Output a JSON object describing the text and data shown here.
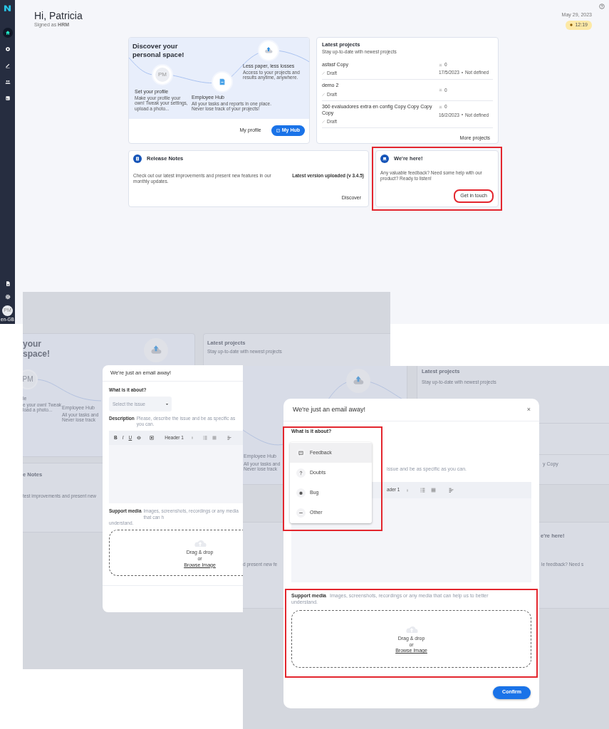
{
  "sidebar": {
    "nav_items": [
      {
        "selected": true
      },
      {
        "selected": false
      },
      {
        "selected": false
      },
      {
        "selected": false
      },
      {
        "selected": false
      }
    ],
    "avatar": "PM",
    "locale": "en-GB"
  },
  "header": {
    "greeting": "Hi, Patricia",
    "signed_as": "Signed as **HRM**",
    "date": "May 29, 2023",
    "clock": "12:19"
  },
  "discover_card": {
    "title": "Discover your personal space!",
    "steps": [
      {
        "title": "Set your profile",
        "text": "Make your profile your own! Tweak your settings, upload a photo...",
        "avatar": "PM"
      },
      {
        "title": "Employee Hub",
        "text": "All your tasks and reports in one place. Never lose track of your projects!"
      },
      {
        "title": "Less paper, less losses",
        "text": "Access to your projects and results anytime, anywhere."
      }
    ],
    "buttons": [
      {
        "label": "My profile",
        "primary": false
      },
      {
        "label": "My Hub",
        "primary": true
      }
    ]
  },
  "projects_card": {
    "title": "Latest projects",
    "subtitle": "Stay up-to-date with newest projects",
    "rows": [
      {
        "name": "asfasf Copy",
        "status": "Draft",
        "members": "0",
        "date": "17/5/2023",
        "deadline": "Not defined"
      },
      {
        "name": "demo 2",
        "status": "Draft",
        "members": "0"
      },
      {
        "name": "360 evaluadores extra en config Copy Copy Copy Copy",
        "status": "Draft",
        "members": "0",
        "date": "16/2/2023",
        "deadline": "Not defined"
      }
    ],
    "more": "More projects"
  },
  "release_card": {
    "title": "Release Notes",
    "text": "Check out our latest improvements and present new features in our monthly updates.",
    "version": "Latest version uploaded (v 3.4.5)",
    "button": "Discover"
  },
  "contact_card": {
    "title": "We're here!",
    "text": "Any valuable feedback? Need some help with our product? Ready to listen!",
    "highlighted": true,
    "button": {
      "label": "Get in touch",
      "circled": true
    }
  },
  "screen_2": {
    "background_texts": [
      {
        "text": "your",
        "kind": "heading"
      },
      {
        "text": "space!",
        "kind": "heading"
      },
      {
        "text": "PM",
        "kind": "avatar"
      },
      {
        "text": "le",
        "kind": "label"
      },
      {
        "text": "e your own! Tweak",
        "kind": "text"
      },
      {
        "text": "load a photo...",
        "kind": "text"
      },
      {
        "text": "Employee Hub",
        "kind": "label"
      },
      {
        "text": "All your tasks and",
        "kind": "text"
      },
      {
        "text": "Never lose track",
        "kind": "text"
      },
      {
        "text": "Latest projects",
        "kind": "title"
      },
      {
        "text": "Stay up-to-date with newest projects",
        "kind": "text"
      },
      {
        "text": "e Notes",
        "kind": "title"
      },
      {
        "text": "test improvements and present new",
        "kind": "text"
      }
    ],
    "modal": {
      "title": "We're just an email away!",
      "about_label": "What is it about?",
      "select_placeholder": "Select the issue",
      "description_label": "Description",
      "description_placeholder": "Please, describe the issue and be as specific as you can.",
      "toolbar": {
        "bold": "B",
        "italic": "I",
        "underline": "U",
        "heading": "Header 1"
      },
      "support_label": "Support media",
      "support_hint_lines": [
        "Images, screenshots, recordings or any media that can h",
        "understand."
      ],
      "drop_text": "Drag & drop",
      "drop_or": "or",
      "browse": "Browse Image"
    }
  },
  "screen_3": {
    "background_texts": [
      {
        "text": "Latest projects",
        "kind": "title"
      },
      {
        "text": "Stay up-to-date with newest projects",
        "kind": "text"
      },
      {
        "text": "Employee Hub",
        "kind": "label"
      },
      {
        "text": "All your tasks and",
        "kind": "text"
      },
      {
        "text": "Never lose track",
        "kind": "text"
      },
      {
        "text": "y Copy",
        "kind": "label"
      },
      {
        "text": "e're here!",
        "kind": "title"
      },
      {
        "text": "d present new fe",
        "kind": "text"
      },
      {
        "text": "le feedback? Need s",
        "kind": "text"
      }
    ],
    "modal": {
      "title": "We're just an email away!",
      "close": "×",
      "about_label": "What is it about?",
      "about_highlighted": true,
      "options": [
        {
          "label": "Feedback",
          "selected": true
        },
        {
          "label": "Doubts",
          "selected": false
        },
        {
          "label": "Bug",
          "selected": false
        },
        {
          "label": "Other",
          "selected": false
        }
      ],
      "description_fragment": "issue and be as specific as you can.",
      "toolbar_fragment": "ader 1",
      "support_label": "Support media",
      "support_hint_lines": [
        "Images, screenshots, recordings or any media that can help us to better",
        "understand."
      ],
      "support_highlighted": true,
      "drop_text": "Drag & drop",
      "drop_or": "or",
      "browse": "Browse Image",
      "confirm": "Confirm"
    }
  }
}
